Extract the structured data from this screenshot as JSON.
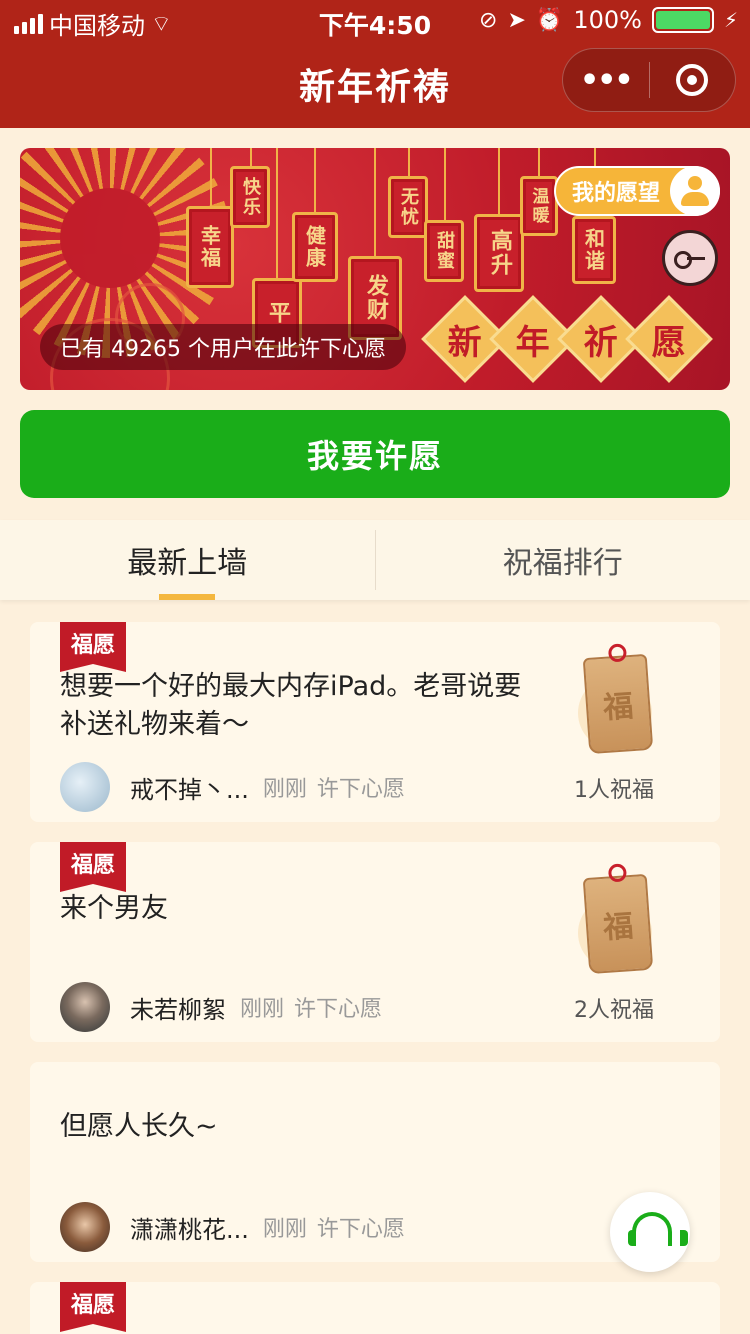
{
  "status": {
    "carrier": "中国移动",
    "time": "下午4:50",
    "battery": "100%"
  },
  "nav": {
    "title": "新年祈祷",
    "more": "•••"
  },
  "banner": {
    "my_wish": "我的愿望",
    "count_text": "已有 49265 个用户在此许下心愿",
    "title_chars": [
      "新",
      "年",
      "祈",
      "愿"
    ],
    "lanterns": [
      "幸福",
      "快乐",
      "平",
      "健康",
      "发财",
      "无忧",
      "甜蜜",
      "高升",
      "温暖",
      "和谐"
    ]
  },
  "main_button": "我要许愿",
  "tabs": [
    {
      "label": "最新上墙",
      "active": true
    },
    {
      "label": "祝福排行",
      "active": false
    }
  ],
  "wishes": [
    {
      "badge": "福愿",
      "text": "想要一个好的最大内存iPad。老哥说要补送礼物来着～",
      "user": "戒不掉丶...",
      "time": "刚刚",
      "action": "许下心愿",
      "tag_char": "福",
      "blessings": "1人祝福"
    },
    {
      "badge": "福愿",
      "text": "来个男友",
      "user": "未若柳絮",
      "time": "刚刚",
      "action": "许下心愿",
      "tag_char": "福",
      "blessings": "2人祝福"
    },
    {
      "badge": "",
      "text": "但愿人长久~",
      "user": "潇潇桃花...",
      "time": "刚刚",
      "action": "许下心愿"
    },
    {
      "badge": "福愿"
    }
  ],
  "colors": {
    "nav_bg": "#b02418",
    "page_bg": "#fdf0dc",
    "green": "#1aad19",
    "badge_red": "#c11b27",
    "gold": "#f4b73e"
  }
}
